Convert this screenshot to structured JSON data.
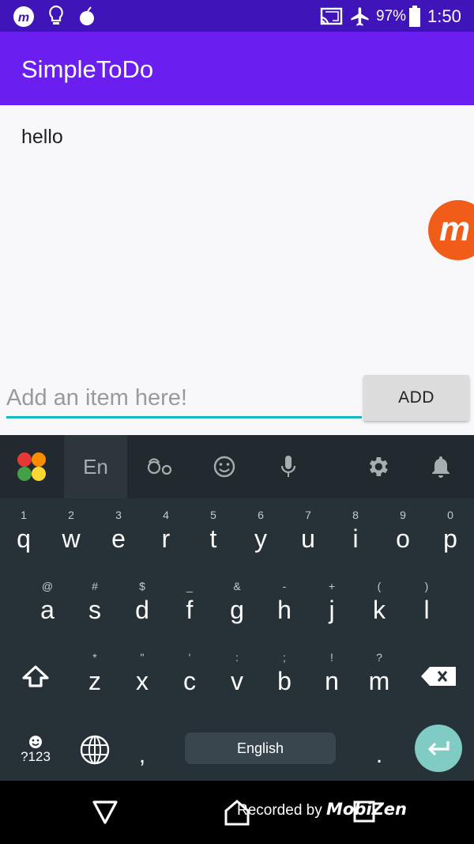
{
  "status_bar": {
    "battery": "97%",
    "time": "1:50"
  },
  "app": {
    "title": "SimpleToDo"
  },
  "list": {
    "items": [
      "hello"
    ]
  },
  "input": {
    "placeholder": "Add an item here!",
    "value": ""
  },
  "add_button": {
    "label": "ADD"
  },
  "keyboard": {
    "toolbar": {
      "language_label": "En"
    },
    "row1": [
      {
        "hint": "1",
        "key": "q"
      },
      {
        "hint": "2",
        "key": "w"
      },
      {
        "hint": "3",
        "key": "e"
      },
      {
        "hint": "4",
        "key": "r"
      },
      {
        "hint": "5",
        "key": "t"
      },
      {
        "hint": "6",
        "key": "y"
      },
      {
        "hint": "7",
        "key": "u"
      },
      {
        "hint": "8",
        "key": "i"
      },
      {
        "hint": "9",
        "key": "o"
      },
      {
        "hint": "0",
        "key": "p"
      }
    ],
    "row2": [
      {
        "hint": "@",
        "key": "a"
      },
      {
        "hint": "#",
        "key": "s"
      },
      {
        "hint": "$",
        "key": "d"
      },
      {
        "hint": "_",
        "key": "f"
      },
      {
        "hint": "&",
        "key": "g"
      },
      {
        "hint": "-",
        "key": "h"
      },
      {
        "hint": "+",
        "key": "j"
      },
      {
        "hint": "(",
        "key": "k"
      },
      {
        "hint": ")",
        "key": "l"
      }
    ],
    "row3": [
      {
        "hint": "*",
        "key": "z"
      },
      {
        "hint": "\"",
        "key": "x"
      },
      {
        "hint": "'",
        "key": "c"
      },
      {
        "hint": ":",
        "key": "v"
      },
      {
        "hint": ";",
        "key": "b"
      },
      {
        "hint": "!",
        "key": "n"
      },
      {
        "hint": "?",
        "key": "m"
      }
    ],
    "symbols_label": "?123",
    "comma": ",",
    "space_label": "English",
    "period": "."
  },
  "nav_bar": {
    "recorded_text": "Recorded by",
    "recorded_brand": "MobiZen"
  },
  "colors": {
    "status_bar": "#3f14b8",
    "app_bar": "#6a1ff0",
    "input_underline": "#19b6c4",
    "keyboard_bg": "#263238",
    "enter_key": "#80cbc4"
  },
  "icons": [
    "mobizen-icon",
    "bulb-icon",
    "bomb-icon",
    "cast-icon",
    "airplane-icon",
    "battery-icon",
    "app-grid-icon",
    "sticker-icon",
    "emoji-icon",
    "mic-icon",
    "gear-icon",
    "bell-icon",
    "shift-icon",
    "backspace-icon",
    "globe-icon",
    "enter-icon",
    "back-icon",
    "home-icon",
    "recents-icon"
  ]
}
